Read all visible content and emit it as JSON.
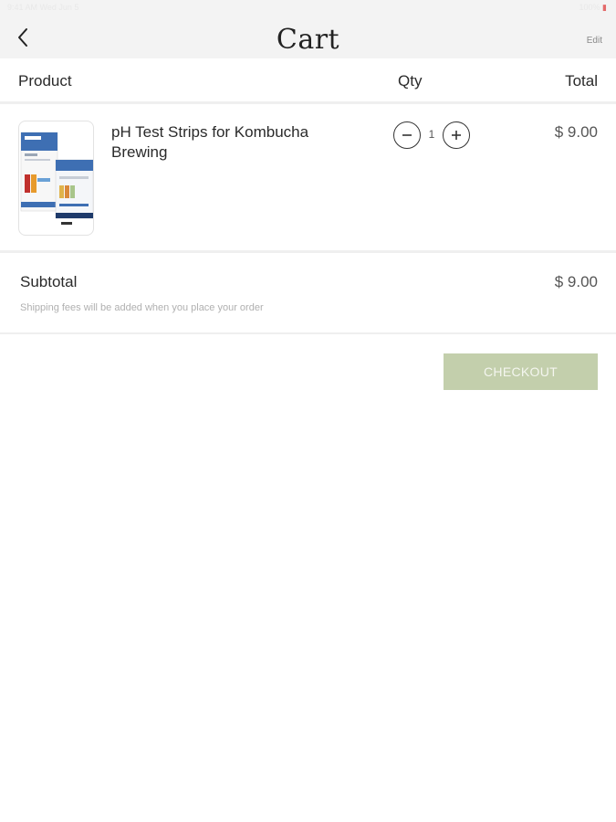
{
  "status_bar": {
    "left": "9:41 AM  Wed Jun 5",
    "right": "100%"
  },
  "header": {
    "title": "Cart",
    "edit_label": "Edit",
    "back_icon": "chevron-left-icon"
  },
  "columns": {
    "product": "Product",
    "qty": "Qty",
    "total": "Total"
  },
  "items": [
    {
      "name": "pH Test Strips for Kombucha Brewing",
      "quantity": "1",
      "total": "$ 9.00",
      "image_icon": "product-package-image"
    }
  ],
  "summary": {
    "subtotal_label": "Subtotal",
    "subtotal_value": "$ 9.00",
    "shipping_note": "Shipping fees will be added when you place your order"
  },
  "checkout": {
    "label": "CHECKOUT"
  },
  "colors": {
    "checkout_bg": "#c3cfac",
    "nav_bg": "#f3f3f3",
    "divider": "#efefef"
  }
}
